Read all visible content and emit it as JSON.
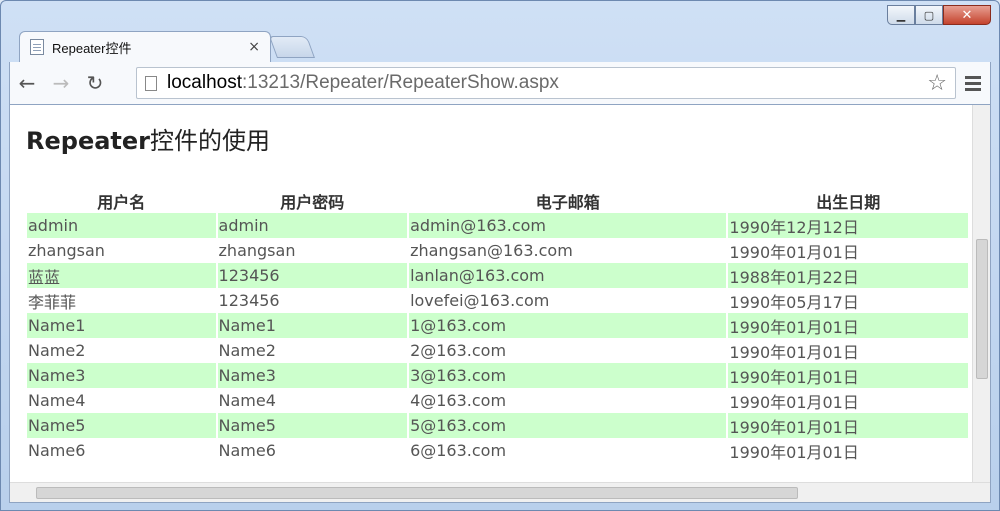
{
  "tab": {
    "title": "Repeater控件",
    "close": "×"
  },
  "window": {
    "minimize": "▁",
    "maximize": "▢",
    "close": "✕"
  },
  "toolbar": {
    "back": "←",
    "forward": "→",
    "reload": "↻"
  },
  "address": {
    "host": "localhost",
    "path": ":13213/Repeater/RepeaterShow.aspx",
    "star": "☆"
  },
  "page": {
    "title_latin": "Repeater",
    "title_cn": "控件的使用",
    "headers": [
      "用户名",
      "用户密码",
      "电子邮箱",
      "出生日期"
    ],
    "rows": [
      [
        "admin",
        "admin",
        "admin@163.com",
        "1990年12月12日"
      ],
      [
        "zhangsan",
        "zhangsan",
        "zhangsan@163.com",
        "1990年01月01日"
      ],
      [
        "蓝蓝",
        "123456",
        "lanlan@163.com",
        "1988年01月22日"
      ],
      [
        "李菲菲",
        "123456",
        "lovefei@163.com",
        "1990年05月17日"
      ],
      [
        "Name1",
        "Name1",
        "1@163.com",
        "1990年01月01日"
      ],
      [
        "Name2",
        "Name2",
        "2@163.com",
        "1990年01月01日"
      ],
      [
        "Name3",
        "Name3",
        "3@163.com",
        "1990年01月01日"
      ],
      [
        "Name4",
        "Name4",
        "4@163.com",
        "1990年01月01日"
      ],
      [
        "Name5",
        "Name5",
        "5@163.com",
        "1990年01月01日"
      ],
      [
        "Name6",
        "Name6",
        "6@163.com",
        "1990年01月01日"
      ]
    ]
  },
  "colors": {
    "alt_row": "#ccffcc"
  }
}
